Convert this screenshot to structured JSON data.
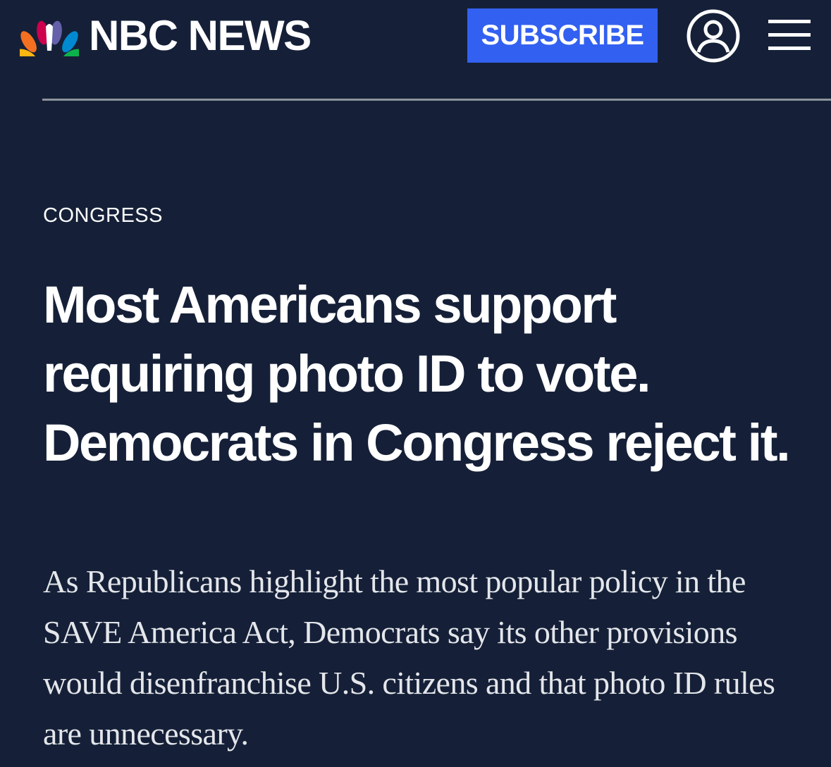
{
  "header": {
    "brand": "NBC NEWS",
    "logo_icon": "peacock-icon",
    "subscribe_label": "SUBSCRIBE",
    "account_icon": "user-circle-icon",
    "menu_icon": "hamburger-menu-icon"
  },
  "article": {
    "category": "CONGRESS",
    "headline": "Most Americans support requiring photo ID to vote. Democrats in Congress reject it.",
    "dek": "As Republicans highlight the most popular policy in the SAVE America Act, Democrats say its other provisions would disenfranchise U.S. citizens and that photo ID rules are unnecessary."
  },
  "colors": {
    "background": "#152038",
    "subscribe_button": "#3260f0",
    "divider": "#8e939c",
    "text": "#ffffff"
  }
}
